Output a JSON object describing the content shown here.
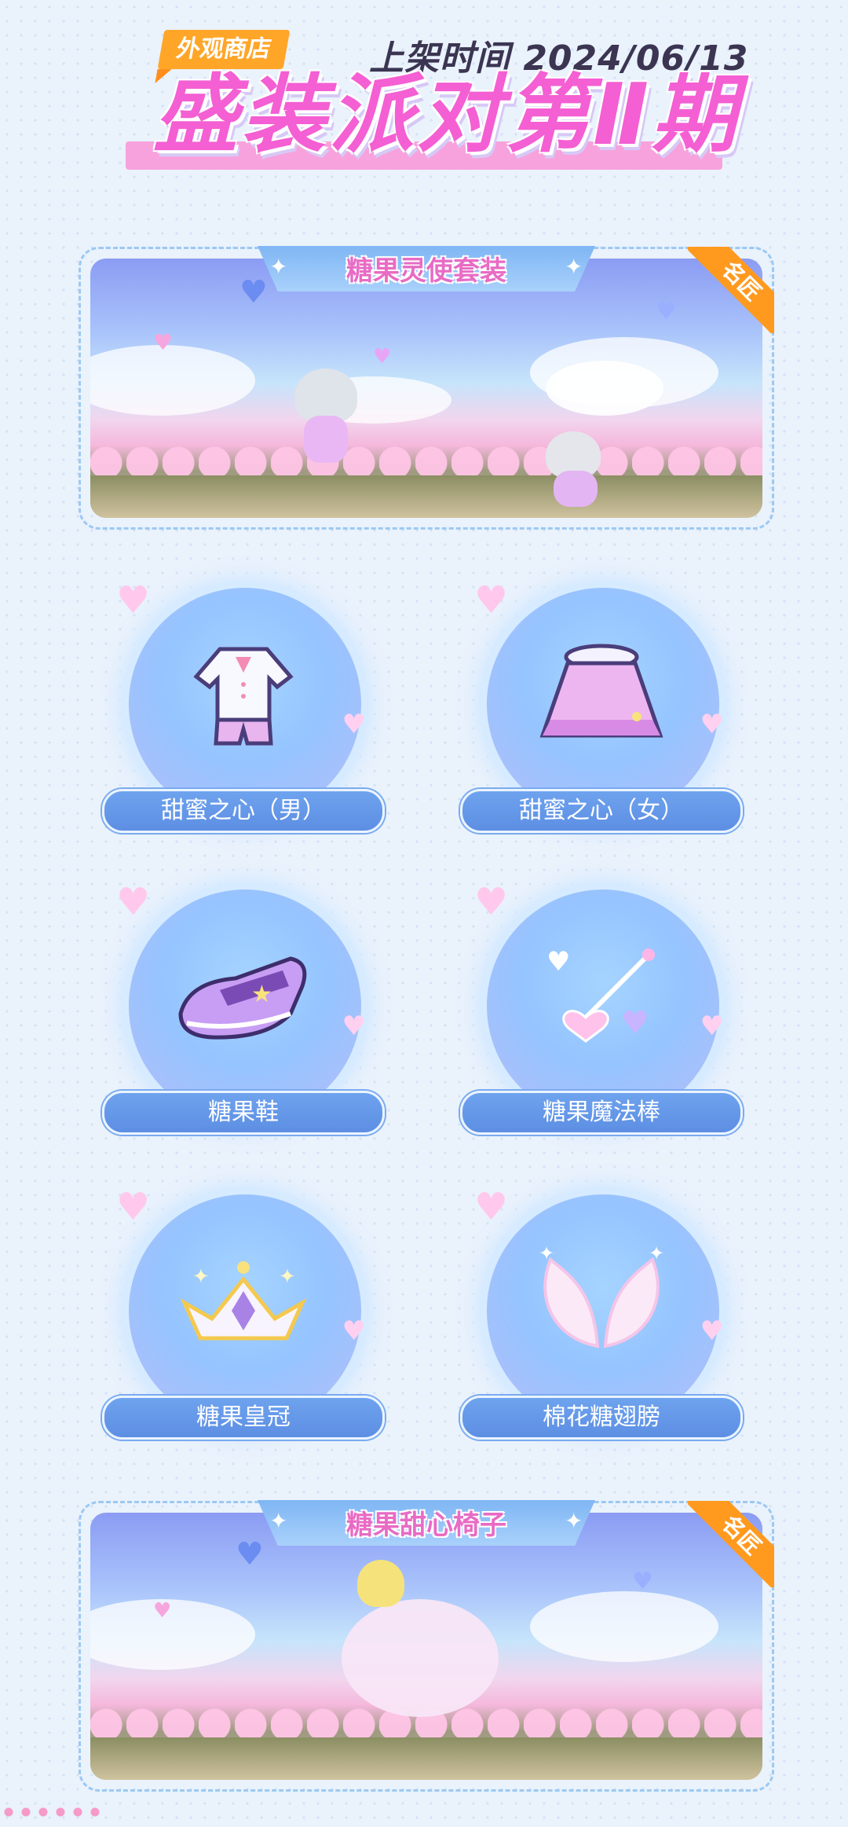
{
  "header": {
    "tag": "外观商店",
    "date": "上架时间 2024/06/13",
    "title": "盛装派对第Ⅱ期"
  },
  "banners": [
    {
      "title": "糖果灵使套装",
      "badge": "名匠"
    },
    {
      "title": "糖果甜心椅子",
      "badge": "名匠"
    }
  ],
  "items": [
    {
      "label": "甜蜜之心（男）",
      "icon": "boy-outfit-icon"
    },
    {
      "label": "甜蜜之心（女）",
      "icon": "girl-dress-icon"
    },
    {
      "label": "糖果鞋",
      "icon": "shoe-icon"
    },
    {
      "label": "糖果魔法棒",
      "icon": "magic-wand-icon"
    },
    {
      "label": "糖果皇冠",
      "icon": "crown-icon"
    },
    {
      "label": "棉花糖翅膀",
      "icon": "wings-icon"
    }
  ],
  "colors": {
    "accent_pink": "#f45fd3",
    "accent_orange": "#ffa629",
    "label_blue": "#6ea3ee"
  }
}
